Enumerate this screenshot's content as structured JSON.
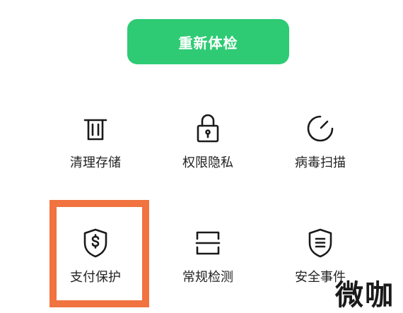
{
  "primary_action": {
    "label": "重新体检",
    "color": "#2ecb74"
  },
  "tools": [
    {
      "label": "清理存储",
      "icon": "trash-icon"
    },
    {
      "label": "权限隐私",
      "icon": "lock-icon"
    },
    {
      "label": "病毒扫描",
      "icon": "scan-gauge-icon"
    },
    {
      "label": "支付保护",
      "icon": "shield-dollar-icon"
    },
    {
      "label": "常规检测",
      "icon": "frame-scan-icon"
    },
    {
      "label": "安全事件",
      "icon": "shield-list-icon"
    }
  ],
  "highlight": {
    "target": "支付保护",
    "color": "#f07340"
  },
  "watermark": {
    "text": "微咖"
  }
}
